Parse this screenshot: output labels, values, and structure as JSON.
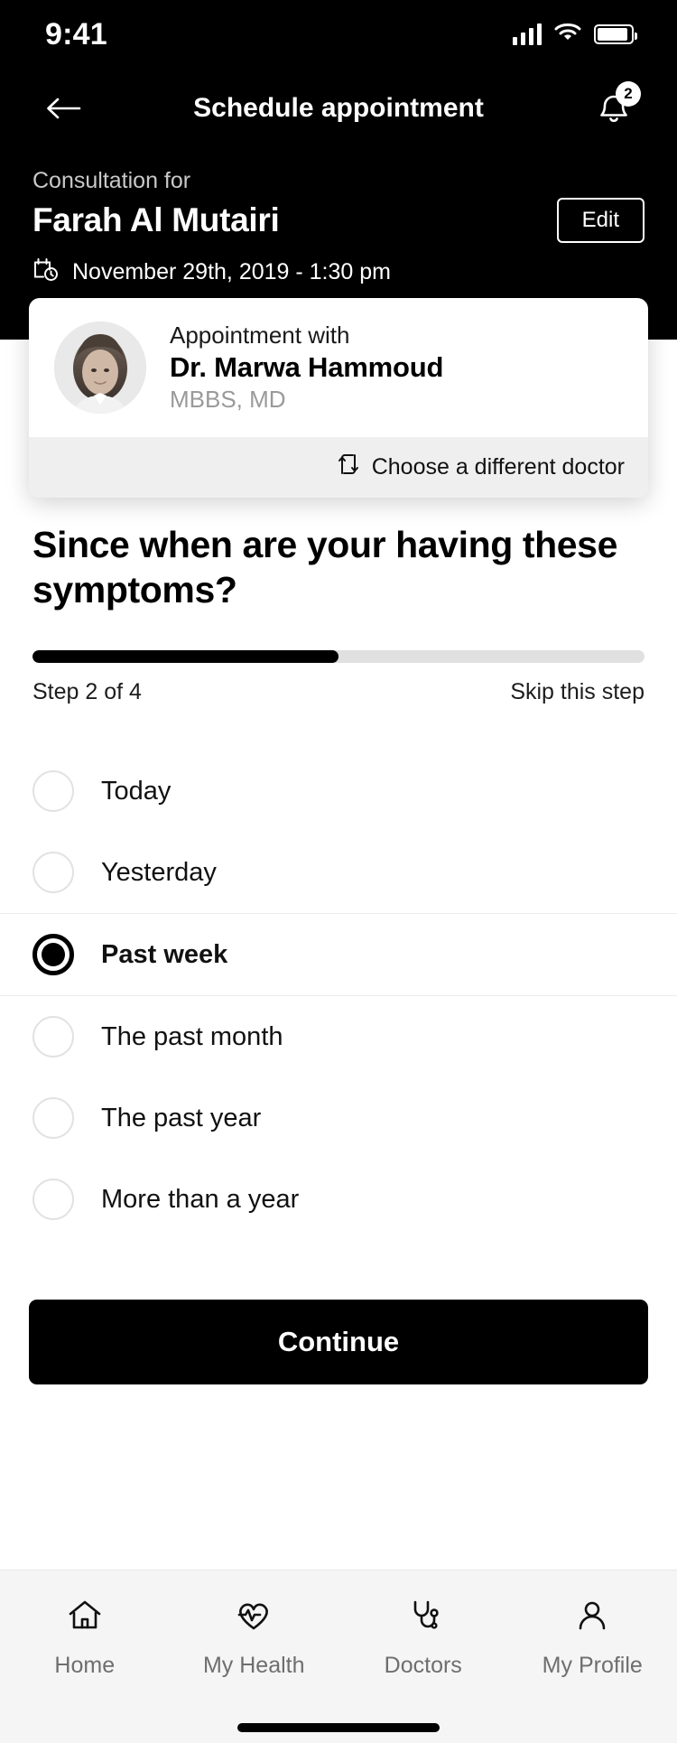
{
  "status_bar": {
    "time": "9:41",
    "signal_icon": "cellular-bars-icon",
    "wifi_icon": "wifi-icon",
    "battery_icon": "battery-icon"
  },
  "header": {
    "back_icon": "back-arrow-icon",
    "title": "Schedule appointment",
    "bell_icon": "bell-icon",
    "notification_count": "2"
  },
  "consultation": {
    "label": "Consultation for",
    "patient_name": "Farah Al Mutairi",
    "edit_label": "Edit",
    "calendar_icon": "calendar-clock-icon",
    "datetime": "November 29th, 2019 - 1:30 pm"
  },
  "doctor_card": {
    "avatar_name": "doctor-avatar",
    "appointment_with": "Appointment with",
    "doctor_name": "Dr. Marwa Hammoud",
    "credentials": "MBBS, MD",
    "swap_icon": "swap-arrows-icon",
    "change_doctor_label": "Choose a different doctor"
  },
  "question_section": {
    "question": "Since when are your having these symptoms?",
    "progress_percent": 50,
    "step_label": "Step 2 of 4",
    "skip_label": "Skip this step"
  },
  "options": [
    {
      "label": "Today",
      "selected": false
    },
    {
      "label": "Yesterday",
      "selected": false
    },
    {
      "label": "Past week",
      "selected": true
    },
    {
      "label": "The past month",
      "selected": false
    },
    {
      "label": "The past year",
      "selected": false
    },
    {
      "label": "More than a year",
      "selected": false
    }
  ],
  "primary_action": {
    "label": "Continue"
  },
  "bottom_nav": [
    {
      "label": "Home",
      "icon": "home-icon"
    },
    {
      "label": "My Health",
      "icon": "heart-pulse-icon"
    },
    {
      "label": "Doctors",
      "icon": "stethoscope-icon"
    },
    {
      "label": "My Profile",
      "icon": "person-icon"
    }
  ],
  "colors": {
    "background": "#ffffff",
    "dark": "#000000",
    "muted_text": "#9a9a9a",
    "track": "#e0e0e0",
    "footer_bg": "#efefef",
    "tabbar_bg": "#f5f5f5"
  }
}
